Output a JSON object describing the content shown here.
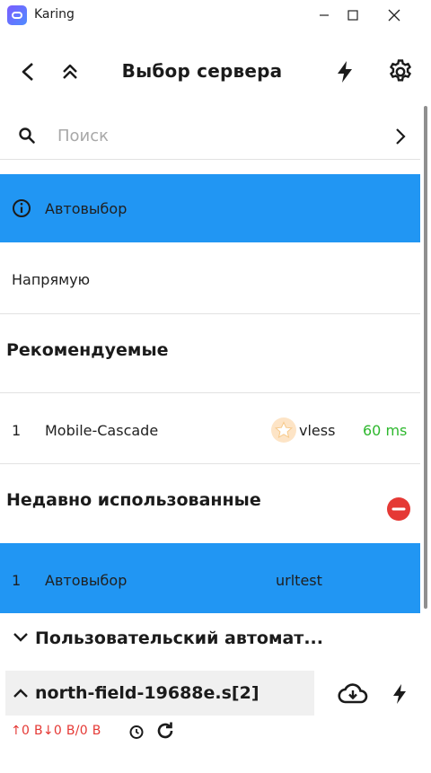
{
  "window": {
    "title": "Karing"
  },
  "header": {
    "title": "Выбор сервера"
  },
  "search": {
    "placeholder": "Поиск"
  },
  "auto_select": {
    "label": "Автовыбор"
  },
  "direct": {
    "label": "Напрямую"
  },
  "recommended": {
    "title": "Рекомендуемые",
    "items": [
      {
        "index": "1",
        "name": "Mobile-Cascade",
        "protocol": "vless",
        "latency": "60 ms"
      }
    ]
  },
  "recent": {
    "title": "Недавно использованные",
    "items": [
      {
        "index": "1",
        "name": "Автовыбор",
        "protocol": "urltest"
      }
    ]
  },
  "custom_group": {
    "label": "Пользовательский автомат..."
  },
  "subscription": {
    "name": "north-field-19688e.s[2]"
  },
  "traffic": {
    "text": "↑0 B↓0 B/0 B"
  },
  "colors": {
    "accent": "#2196f3",
    "latency": "#2eb82e",
    "danger": "#e53935",
    "star": "#ffd27a"
  }
}
